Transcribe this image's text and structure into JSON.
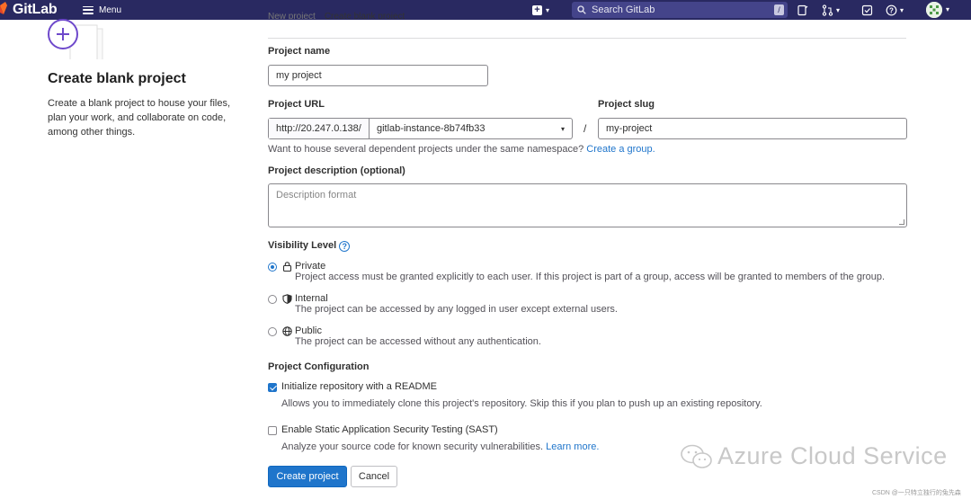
{
  "navbar": {
    "brand": "GitLab",
    "menu_label": "Menu",
    "search_placeholder": "Search GitLab",
    "search_shortcut": "/",
    "new_plus": "+"
  },
  "left": {
    "title": "Create blank project",
    "description": "Create a blank project to house your files, plan your work, and collaborate on code, among other things."
  },
  "breadcrumb": {
    "parent": "New project",
    "current": "Create blank project"
  },
  "form": {
    "project_name_label": "Project name",
    "project_name_value": "my project",
    "project_url_label": "Project URL",
    "url_prefix": "http://20.247.0.138/",
    "namespace": "gitlab-instance-8b74fb33",
    "slug_separator": "/",
    "project_slug_label": "Project slug",
    "project_slug_value": "my-project",
    "namespace_help": "Want to house several dependent projects under the same namespace?",
    "namespace_help_link": "Create a group.",
    "description_label": "Project description (optional)",
    "description_placeholder": "Description format",
    "visibility_label": "Visibility Level",
    "visibility_help": "?",
    "visibility": [
      {
        "title": "Private",
        "icon": "lock-icon",
        "checked": true,
        "desc": "Project access must be granted explicitly to each user. If this project is part of a group, access will be granted to members of the group."
      },
      {
        "title": "Internal",
        "icon": "shield-icon",
        "checked": false,
        "desc": "The project can be accessed by any logged in user except external users."
      },
      {
        "title": "Public",
        "icon": "globe-icon",
        "checked": false,
        "desc": "The project can be accessed without any authentication."
      }
    ],
    "config_label": "Project Configuration",
    "readme_label": "Initialize repository with a README",
    "readme_checked": true,
    "readme_desc": "Allows you to immediately clone this project's repository. Skip this if you plan to push up an existing repository.",
    "sast_label": "Enable Static Application Security Testing (SAST)",
    "sast_checked": false,
    "sast_desc": "Analyze your source code for known security vulnerabilities.",
    "sast_link": "Learn more.",
    "create_button": "Create project",
    "cancel_button": "Cancel"
  },
  "watermark": {
    "text": "Azure Cloud Service",
    "csdn": "CSDN @一只特立独行的兔先森"
  },
  "colors": {
    "navbar": "#292961",
    "primary": "#1f75cb",
    "link": "#1f75cb"
  }
}
